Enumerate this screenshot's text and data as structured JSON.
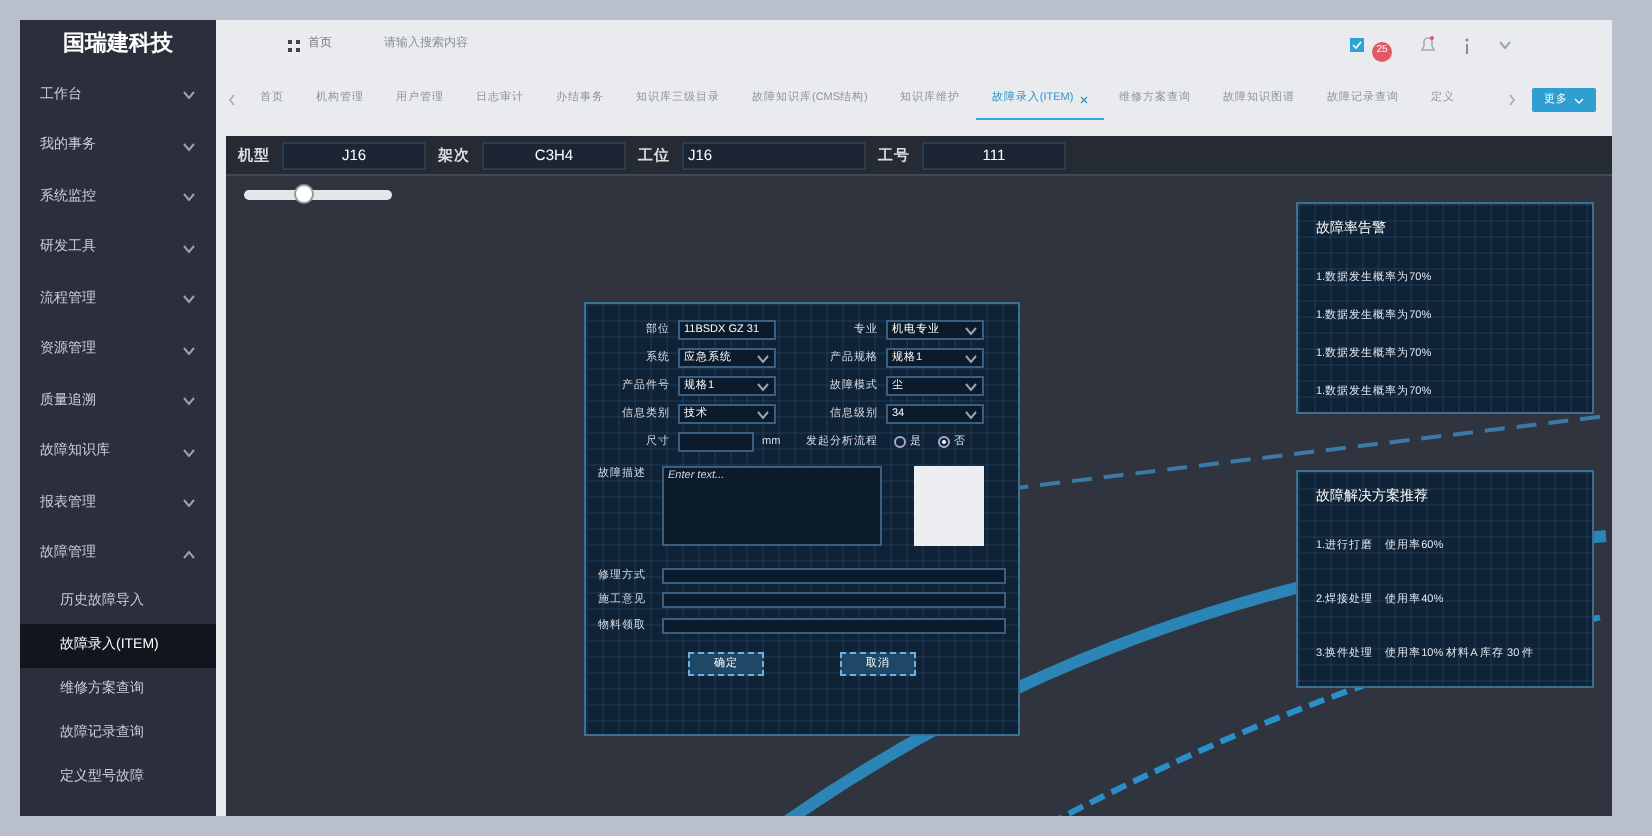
{
  "sidebar": {
    "logo": "国瑞建科技",
    "items": [
      {
        "label": "工作台",
        "expanded": false
      },
      {
        "label": "我的事务",
        "expanded": false
      },
      {
        "label": "系统监控",
        "expanded": false
      },
      {
        "label": "研发工具",
        "expanded": false
      },
      {
        "label": "流程管理",
        "expanded": false
      },
      {
        "label": "资源管理",
        "expanded": false
      },
      {
        "label": "质量追溯",
        "expanded": false
      },
      {
        "label": "故障知识库",
        "expanded": false
      },
      {
        "label": "报表管理",
        "expanded": false
      },
      {
        "label": "故障管理",
        "expanded": true,
        "children": [
          {
            "label": "历史故障导入",
            "selected": false
          },
          {
            "label": "故障录入(ITEM)",
            "selected": true
          },
          {
            "label": "维修方案查询",
            "selected": false
          },
          {
            "label": "故障记录查询",
            "selected": false
          },
          {
            "label": "定义型号故障",
            "selected": false
          }
        ]
      }
    ]
  },
  "header": {
    "breadcrumb": "首页",
    "search": {
      "placeholder": "请输入搜索内容"
    },
    "badge": "25"
  },
  "tabs": [
    {
      "label": "首页",
      "selected": false,
      "closable": false
    },
    {
      "label": "机构管理",
      "selected": false,
      "closable": false
    },
    {
      "label": "用户管理",
      "selected": false,
      "closable": false
    },
    {
      "label": "日志审计",
      "selected": false,
      "closable": false
    },
    {
      "label": "办结事务",
      "selected": false,
      "closable": false
    },
    {
      "label": "知识库三级目录",
      "selected": false,
      "closable": false
    },
    {
      "label": "故障知识库(CMS结构)",
      "selected": false,
      "closable": false
    },
    {
      "label": "知识库维护",
      "selected": false,
      "closable": false
    },
    {
      "label": "故障录入(ITEM)",
      "selected": true,
      "closable": true
    },
    {
      "label": "维修方案查询",
      "selected": false,
      "closable": false
    },
    {
      "label": "故障知识图谱",
      "selected": false,
      "closable": false
    },
    {
      "label": "故障记录查询",
      "selected": false,
      "closable": false
    },
    {
      "label": "定义",
      "selected": false,
      "closable": false
    }
  ],
  "more_button": "更多",
  "info_bar": [
    {
      "label": "机型",
      "value": "J16"
    },
    {
      "label": "架次",
      "value": "C3H4"
    },
    {
      "label": "工位",
      "value": "J16"
    },
    {
      "label": "工号",
      "value": "111"
    }
  ],
  "slider": {
    "level": 0.4
  },
  "form": {
    "fields": [
      {
        "kind": "text",
        "label": "部位",
        "value": "11BSDX GZ 31"
      },
      {
        "kind": "select",
        "label": "专业",
        "value": "机电专业"
      },
      {
        "kind": "select",
        "label": "系统",
        "value": "应急系统"
      },
      {
        "kind": "select",
        "label": "产品规格",
        "value": "规格1"
      },
      {
        "kind": "select",
        "label": "产品件号",
        "value": "规格1"
      },
      {
        "kind": "select",
        "label": "故障模式",
        "value": "尘"
      },
      {
        "kind": "select",
        "label": "信息类别",
        "value": "技术"
      },
      {
        "kind": "select",
        "label": "信息级别",
        "value": "34"
      }
    ],
    "size": {
      "label": "尺寸",
      "unit": "mm"
    },
    "analysis": {
      "label": "发起分析流程",
      "options": [
        {
          "label": "是",
          "selected": false
        },
        {
          "label": "否",
          "selected": true
        }
      ]
    },
    "description": {
      "label": "故障描述",
      "placeholder": "Enter text..."
    },
    "lines": [
      {
        "label": "修理方式"
      },
      {
        "label": "施工意见"
      },
      {
        "label": "物料领取"
      }
    ],
    "buttons": [
      "确定",
      "取消"
    ]
  },
  "alerts": {
    "title": "故障率告警",
    "items": [
      "1.数据发生概率为70%",
      "1.数据发生概率为70%",
      "1.数据发生概率为70%",
      "1.数据发生概率为70%"
    ]
  },
  "solutions": {
    "title": "故障解决方案推荐",
    "items": [
      "1.进行打磨　使用率60%",
      "2.焊接处理　使用率40%",
      "3.换件处理　使用率10% 材料A 库存 30 件"
    ]
  }
}
